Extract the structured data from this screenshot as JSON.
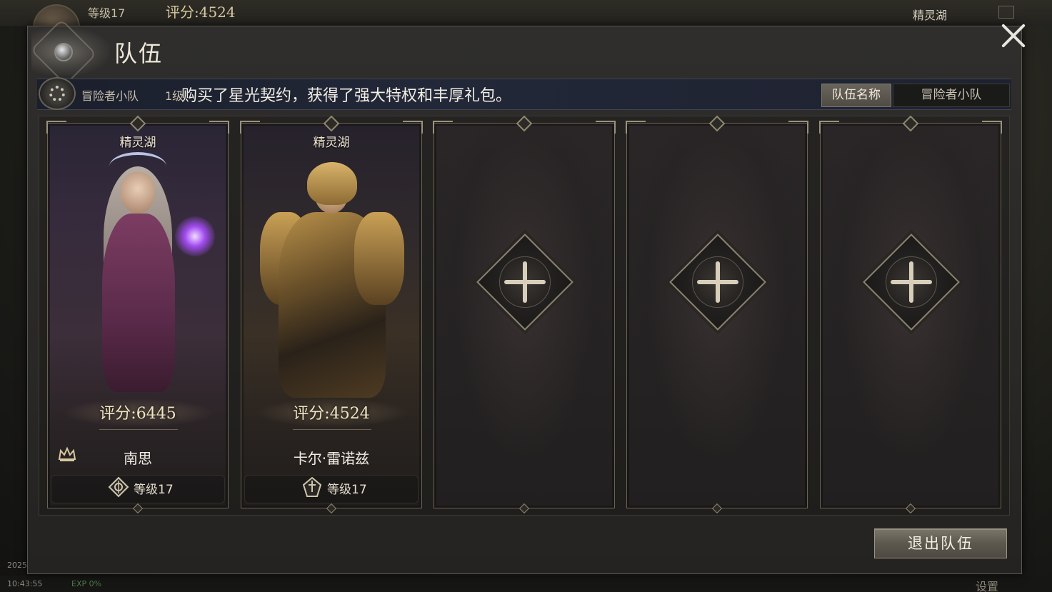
{
  "hud": {
    "level": "等级17",
    "score": "评分:4524",
    "zone": "精灵湖",
    "time": "10:43:55",
    "exp": "EXP 0%",
    "year": "2025",
    "settings": "设置"
  },
  "panel": {
    "title": "队伍",
    "team_name": "冒险者小队",
    "level_req": "1级",
    "marquee": "购买了星光契约，获得了强大特权和丰厚礼包。",
    "tabs": [
      {
        "label": "队伍名称",
        "active": true
      },
      {
        "label": "冒险者小队",
        "active": false
      }
    ],
    "leave_label": "退出队伍"
  },
  "members": [
    {
      "server": "精灵湖",
      "score": "评分:6445",
      "name": "南思",
      "level": "等级17",
      "is_leader": true,
      "class_icon": "mage-class-icon"
    },
    {
      "server": "精灵湖",
      "score": "评分:4524",
      "name": "卡尔·雷诺兹",
      "level": "等级17",
      "is_leader": false,
      "class_icon": "warrior-class-icon"
    }
  ],
  "empty_slots": 3,
  "icons": {
    "close": "close-icon",
    "gear": "gear-icon",
    "crown": "crown-icon",
    "add": "plus-icon"
  },
  "colors": {
    "panel_bg": "#2b2a28",
    "accent_gold": "#d8c89f",
    "text_light": "#efe8da"
  }
}
